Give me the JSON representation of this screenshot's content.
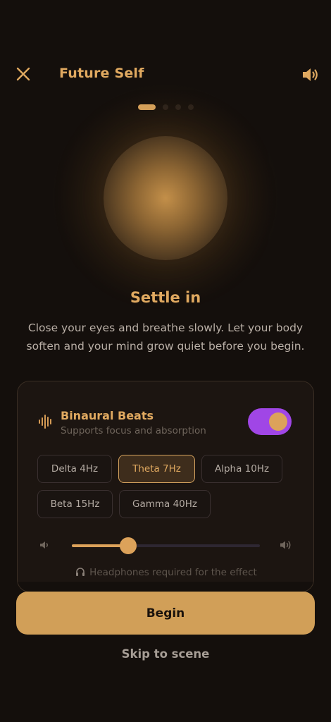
{
  "header": {
    "title": "Future Self",
    "close_icon": "close-icon",
    "sound_icon": "speaker-on-icon"
  },
  "pager": {
    "total": 4,
    "active_index": 0
  },
  "hero": {
    "heading": "Settle in",
    "description": "Close your eyes and breathe slowly. Let your body soften and your mind grow quiet before you begin."
  },
  "binaural": {
    "title": "Binaural Beats",
    "subtitle": "Supports focus and absorption",
    "icon": "soundwave-icon",
    "enabled": true,
    "toggle_color": "#a046e6",
    "frequencies": [
      "Delta 4Hz",
      "Theta 7Hz",
      "Alpha 10Hz",
      "Beta 15Hz",
      "Gamma 40Hz"
    ],
    "selected": "Theta 7Hz",
    "volume_fraction": 0.3,
    "headphones_note": "Headphones required for the effect"
  },
  "actions": {
    "begin_label": "Begin",
    "skip_label": "Skip to scene"
  },
  "colors": {
    "accent": "#e0a960",
    "button": "#d19f58",
    "background": "#140f0c"
  }
}
